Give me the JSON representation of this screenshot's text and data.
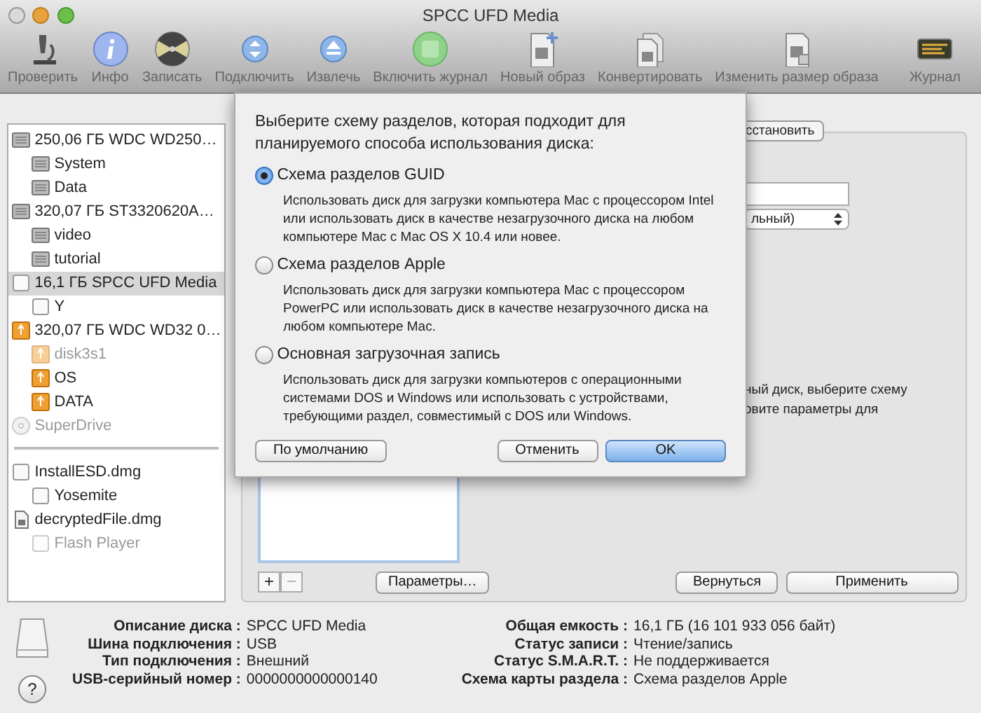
{
  "window": {
    "title": "SPCC UFD Media"
  },
  "toolbar": [
    {
      "label": "Проверить",
      "kind": "microscope"
    },
    {
      "label": "Инфо",
      "kind": "info"
    },
    {
      "label": "Записать",
      "kind": "burn"
    },
    {
      "label": "Подключить",
      "kind": "mount"
    },
    {
      "label": "Извлечь",
      "kind": "eject"
    },
    {
      "label": "Включить журнал",
      "kind": "journal"
    },
    {
      "label": "Новый образ",
      "kind": "new-image"
    },
    {
      "label": "Конвертировать",
      "kind": "convert"
    },
    {
      "label": "Изменить размер образа",
      "kind": "resize"
    },
    {
      "label": "Журнал",
      "kind": "log"
    }
  ],
  "sidebar": {
    "devices": [
      {
        "label": "250,06 ГБ WDC WD250…",
        "kind": "hdd",
        "selected": false,
        "disabled": false,
        "children": [
          {
            "label": "System",
            "kind": "hdd",
            "selected": false,
            "disabled": false
          },
          {
            "label": "Data",
            "kind": "hdd",
            "selected": false,
            "disabled": false
          }
        ]
      },
      {
        "label": "320,07 ГБ ST3320620A…",
        "kind": "hdd",
        "selected": false,
        "disabled": false,
        "children": [
          {
            "label": "video",
            "kind": "hdd",
            "selected": false,
            "disabled": false
          },
          {
            "label": "tutorial",
            "kind": "hdd",
            "selected": false,
            "disabled": false
          }
        ]
      },
      {
        "label": "16,1 ГБ SPCC UFD Media",
        "kind": "flash",
        "selected": true,
        "disabled": false,
        "children": [
          {
            "label": "Y",
            "kind": "flash",
            "selected": false,
            "disabled": false
          }
        ]
      },
      {
        "label": "320,07 ГБ WDC WD32 0…",
        "kind": "external",
        "selected": false,
        "disabled": false,
        "children": [
          {
            "label": "disk3s1",
            "kind": "external",
            "selected": false,
            "disabled": true
          },
          {
            "label": "OS",
            "kind": "external",
            "selected": false,
            "disabled": false
          },
          {
            "label": "DATA",
            "kind": "external",
            "selected": false,
            "disabled": false
          }
        ]
      },
      {
        "label": "SuperDrive",
        "kind": "optical",
        "selected": false,
        "disabled": true
      }
    ],
    "images": [
      {
        "label": "InstallESD.dmg",
        "kind": "flash",
        "selected": false,
        "disabled": false,
        "children": [
          {
            "label": "Yosemite",
            "kind": "flash",
            "selected": false,
            "disabled": false
          }
        ]
      },
      {
        "label": "decryptedFile.dmg",
        "kind": "dmg",
        "selected": false,
        "disabled": false,
        "children": [
          {
            "label": "Flash Player",
            "kind": "flash",
            "selected": false,
            "disabled": true
          }
        ]
      }
    ]
  },
  "panel": {
    "tab_fragment": "сстановить",
    "popup_fragment": "льный)",
    "text_lines": [
      "ный диск, выберите схему",
      "овите параметры для"
    ],
    "add_button": "+",
    "remove_button": "−",
    "options_button": "Параметры…",
    "revert_button": "Вернуться",
    "apply_button": "Применить"
  },
  "sheet": {
    "prompt": "Выберите схему разделов, которая подходит для планируемого способа использования диска:",
    "options": [
      {
        "label": "Схема разделов GUID",
        "selected": true,
        "description": "Использовать диск для загрузки компьютера Mac с процессором Intel или использовать диск в качестве незагрузочного диска на любом компьютере Mac с Mac OS X 10.4 или новее."
      },
      {
        "label": "Схема разделов Apple",
        "selected": false,
        "description": "Использовать диск для загрузки компьютера Mac с процессором PowerPC или использовать диск в качестве незагрузочного диска на любом компьютере Mac."
      },
      {
        "label": "Основная загрузочная запись",
        "selected": false,
        "description": "Использовать диск для загрузки компьютеров с операционными системами DOS и Windows или использовать с устройствами, требующими раздел, совместимый с DOS или Windows."
      }
    ],
    "buttons": [
      {
        "label": "По умолчанию",
        "kind": "plain"
      },
      {
        "label": "Отменить",
        "kind": "plain"
      },
      {
        "label": "OK",
        "kind": "default"
      }
    ]
  },
  "info": {
    "left": [
      {
        "label": "Описание диска :",
        "value": "SPCC UFD Media"
      },
      {
        "label": "Шина подключения :",
        "value": "USB"
      },
      {
        "label": "Тип подключения :",
        "value": "Внешний"
      },
      {
        "label": "USB-серийный номер :",
        "value": "0000000000000140"
      }
    ],
    "right": [
      {
        "label": "Общая емкость :",
        "value": "16,1 ГБ (16 101 933 056 байт)"
      },
      {
        "label": "Статус записи :",
        "value": "Чтение/запись"
      },
      {
        "label": "Статус S.M.A.R.T. :",
        "value": "Не поддерживается"
      },
      {
        "label": "Схема карты раздела :",
        "value": "Схема разделов Apple"
      }
    ],
    "help_button": "?"
  }
}
